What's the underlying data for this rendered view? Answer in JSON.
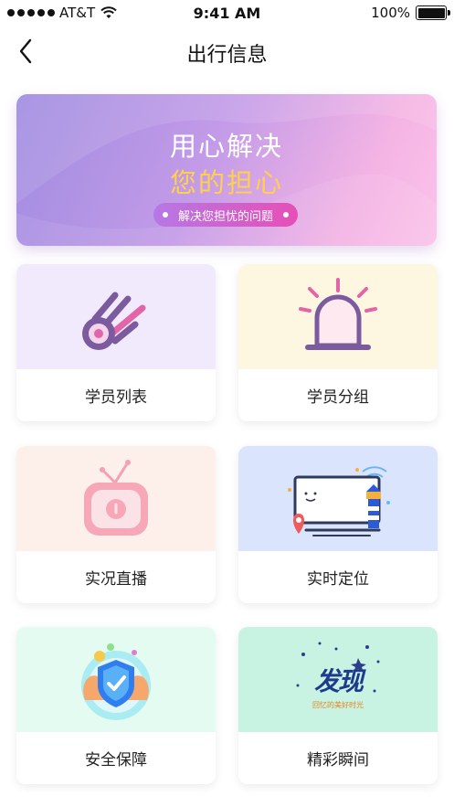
{
  "status_bar": {
    "carrier": "AT&T",
    "time": "9:41 AM",
    "battery": "100%"
  },
  "nav": {
    "title": "出行信息"
  },
  "banner": {
    "line1": "用心解决",
    "line2": "您的担心",
    "pill": "解决您担忧的问题"
  },
  "cards": [
    {
      "label": "学员列表",
      "icon": "comet-icon",
      "bg": "#f1eafd"
    },
    {
      "label": "学员分组",
      "icon": "alarm-light-icon",
      "bg": "#fdf6e1"
    },
    {
      "label": "实况直播",
      "icon": "tv-icon",
      "bg": "#fdefe9"
    },
    {
      "label": "实时定位",
      "icon": "monitor-lighthouse-icon",
      "bg": "#dbe4fd"
    },
    {
      "label": "安全保障",
      "icon": "shield-hands-icon",
      "bg": "#e3fbf1"
    },
    {
      "label": "精彩瞬间",
      "icon": "discover-icon",
      "bg": "#c8f2e2"
    }
  ],
  "discover_art": {
    "title": "发现",
    "caption": "回忆的美好时光"
  },
  "colors": {
    "banner_accent": "#ffd14a",
    "pill_gradient": [
      "#b678e6",
      "#e64fb5"
    ]
  }
}
